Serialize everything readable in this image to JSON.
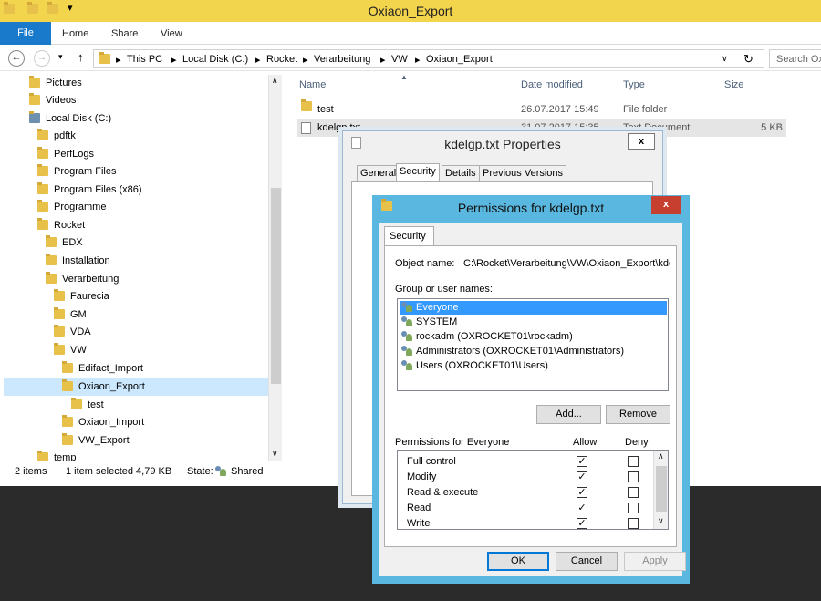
{
  "explorer": {
    "title": "Oxiaon_Export",
    "ribbon": {
      "file": "File",
      "home": "Home",
      "share": "Share",
      "view": "View"
    },
    "breadcrumb": [
      "This PC",
      "Local Disk (C:)",
      "Rocket",
      "Verarbeitung",
      "VW",
      "Oxiaon_Export"
    ],
    "search_placeholder": "Search Oxiaon_Export",
    "nav": [
      {
        "label": "Pictures"
      },
      {
        "label": "Videos"
      },
      {
        "label": "Local Disk (C:)"
      },
      {
        "label": "pdftk"
      },
      {
        "label": "PerfLogs"
      },
      {
        "label": "Program Files"
      },
      {
        "label": "Program Files (x86)"
      },
      {
        "label": "Programme"
      },
      {
        "label": "Rocket"
      },
      {
        "label": "EDX"
      },
      {
        "label": "Installation"
      },
      {
        "label": "Verarbeitung"
      },
      {
        "label": "Faurecia"
      },
      {
        "label": "GM"
      },
      {
        "label": "VDA"
      },
      {
        "label": "VW"
      },
      {
        "label": "Edifact_Import"
      },
      {
        "label": "Oxiaon_Export"
      },
      {
        "label": "test"
      },
      {
        "label": "Oxiaon_Import"
      },
      {
        "label": "VW_Export"
      },
      {
        "label": "temp"
      }
    ],
    "columns": {
      "name": "Name",
      "date": "Date modified",
      "type": "Type",
      "size": "Size"
    },
    "files": [
      {
        "name": "test",
        "date": "26.07.2017 15:49",
        "type": "File folder",
        "size": ""
      },
      {
        "name": "kdelgp.txt",
        "date": "31.07.2017 15:35",
        "type": "Text Document",
        "size": "5 KB"
      }
    ],
    "status": {
      "items": "2 items",
      "selected": "1 item selected  4,79 KB",
      "state_label": "State:",
      "state_value": "Shared"
    }
  },
  "properties": {
    "title": "kdelgp.txt Properties",
    "close": "x",
    "tabs": [
      "General",
      "Security",
      "Details",
      "Previous Versions"
    ]
  },
  "permissions": {
    "title": "Permissions for kdelgp.txt",
    "close": "x",
    "tab": "Security",
    "object_name_label": "Object name:",
    "object_name_value": "C:\\Rocket\\Verarbeitung\\VW\\Oxiaon_Export\\kdelg",
    "group_label": "Group or user names:",
    "groups": [
      "Everyone",
      "SYSTEM",
      "rockadm (OXROCKET01\\rockadm)",
      "Administrators (OXROCKET01\\Administrators)",
      "Users (OXROCKET01\\Users)"
    ],
    "add_button": "Add...",
    "remove_button": "Remove",
    "perm_header": "Permissions for Everyone",
    "allow_header": "Allow",
    "deny_header": "Deny",
    "perms": [
      {
        "name": "Full control",
        "allow": "✓",
        "deny": ""
      },
      {
        "name": "Modify",
        "allow": "✓",
        "deny": ""
      },
      {
        "name": "Read & execute",
        "allow": "✓",
        "deny": ""
      },
      {
        "name": "Read",
        "allow": "✓",
        "deny": ""
      },
      {
        "name": "Write",
        "allow": "✓",
        "deny": ""
      }
    ],
    "ok": "OK",
    "cancel": "Cancel",
    "apply": "Apply"
  }
}
